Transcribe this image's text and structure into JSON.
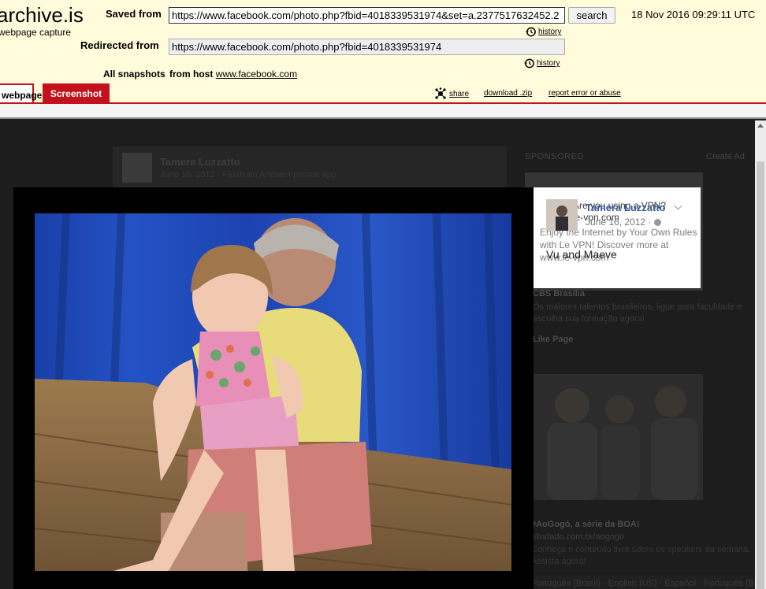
{
  "header": {
    "logo": "archive.is",
    "logo_sub": "webpage capture",
    "saved_from_label": "Saved from",
    "saved_from_url": "https://www.facebook.com/photo.php?fbid=4018339531974&set=a.2377517632452.2",
    "search_label": "search",
    "timestamp": "18 Nov 2016 09:29:11 UTC",
    "history_label": "history",
    "redirected_from_label": "Redirected from",
    "redirected_from_url": "https://www.facebook.com/photo.php?fbid=4018339531974",
    "all_snapshots_label": "All snapshots",
    "from_host_label": "from host",
    "host": "www.facebook.com"
  },
  "tabs": {
    "webpage": "webpage",
    "screenshot": "Screenshot"
  },
  "actions": {
    "share": "share",
    "download": "download .zip",
    "report": "report error or abuse"
  },
  "fb": {
    "bg_post_name": "Tamera Luzzatto",
    "bg_post_meta": "June 16, 2012 · FirstRain Ambient photos app",
    "sponsored": "SPONSORED",
    "create_ad": "Create Ad",
    "ad1_title": "Are you using a VPN?",
    "ad1_url": "le-vpn.com",
    "ad1_body": "Enjoy the Internet by Your Own Rules with Le VPN! Discover more at www.le-vpn.com",
    "ad2_title": "CBS Brasília",
    "ad2_body": "Os maiores talentos brasileiros, ligue para faculdade e escolha sua formação agora!",
    "like_page": "Like Page",
    "ad3_title": "#AoGogó, a série da BOA!",
    "ad3_url": "blindado.com.br/aogogo",
    "ad3_body": "Conheça o conteúdo livre sobre os speakers da semana. Assista agora!",
    "bottom_links": "Português (Brasil) · English (US) · Español · Português (Brasil)"
  },
  "photo_info": {
    "name": "Tamera Luzzatto",
    "date": "June 16, 2012 ·",
    "caption": "Vu and Maeve"
  },
  "colors": {
    "archive_red": "#c4121c",
    "header_bg": "#fffbdb",
    "fb_blue": "#3b5998"
  }
}
